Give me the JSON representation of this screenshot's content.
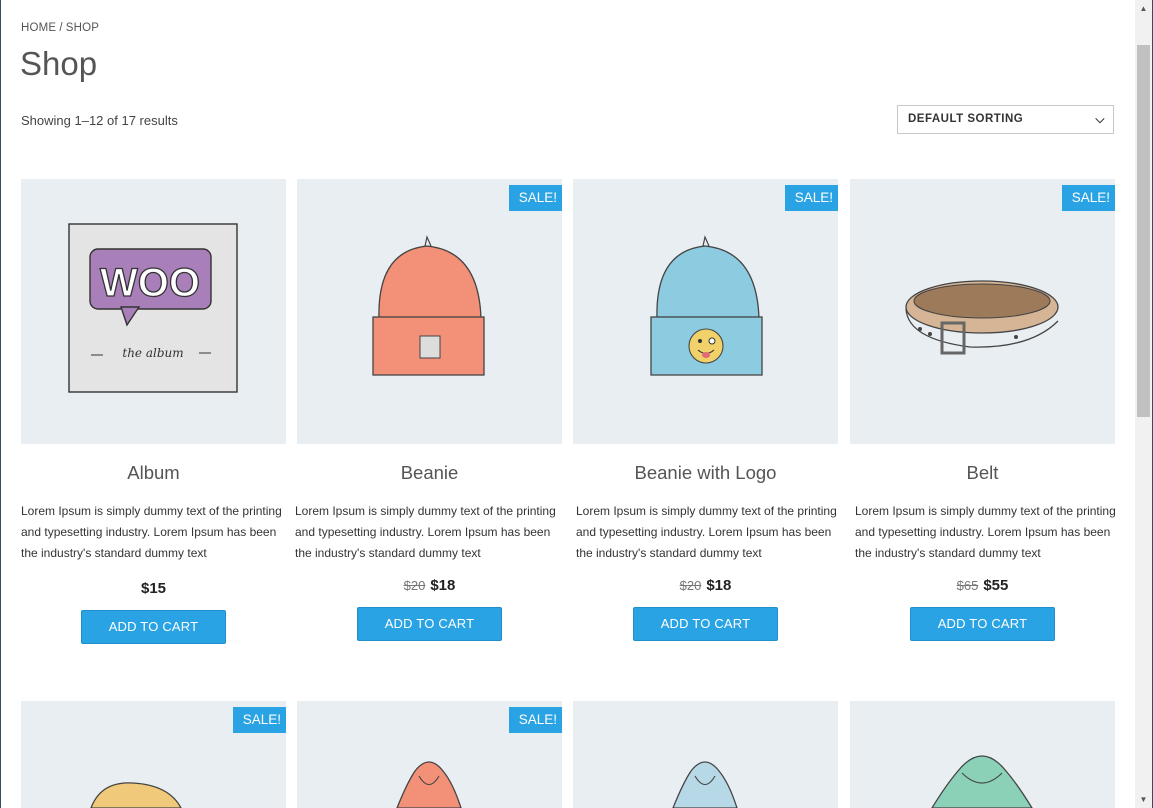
{
  "breadcrumb": {
    "home": "HOME",
    "separator": "/",
    "current": "SHOP"
  },
  "page": {
    "title": "Shop",
    "result_count": "Showing 1–12 of 17 results",
    "sort_selected": "DEFAULT SORTING"
  },
  "colors": {
    "accent": "#29a3e3",
    "thumb_bg": "#e8eef2"
  },
  "products": [
    {
      "name": "Album",
      "sale": "",
      "old_price": "",
      "price": "$15",
      "desc": "Lorem Ipsum is simply dummy text of the printing and typesetting industry. Lorem Ipsum has been the industry's standard dummy text",
      "button": "ADD TO CART",
      "image": "album-cover-image",
      "album_logo": "WOO",
      "album_caption": "the album"
    },
    {
      "name": "Beanie",
      "sale": "SALE!",
      "old_price": "$20",
      "price": "$18",
      "desc": "Lorem Ipsum is simply dummy text of the printing and typesetting industry. Lorem Ipsum has been the industry's standard dummy text",
      "button": "ADD TO CART",
      "image": "orange-beanie-image"
    },
    {
      "name": "Beanie with Logo",
      "sale": "SALE!",
      "old_price": "$20",
      "price": "$18",
      "desc": "Lorem Ipsum is simply dummy text of the printing and typesetting industry. Lorem Ipsum has been the industry's standard dummy text",
      "button": "ADD TO CART",
      "image": "blue-beanie-image"
    },
    {
      "name": "Belt",
      "sale": "SALE!",
      "old_price": "$65",
      "price": "$55",
      "desc": "Lorem Ipsum is simply dummy text of the printing and typesetting industry. Lorem Ipsum has been the industry's standard dummy text",
      "button": "ADD TO CART",
      "image": "belt-image"
    },
    {
      "sale": "SALE!",
      "image": "cap-image"
    },
    {
      "sale": "SALE!",
      "image": "orange-hoodie-image"
    },
    {
      "sale": "",
      "image": "blue-hoodie-image"
    },
    {
      "sale": "",
      "image": "green-hoodie-image"
    }
  ]
}
